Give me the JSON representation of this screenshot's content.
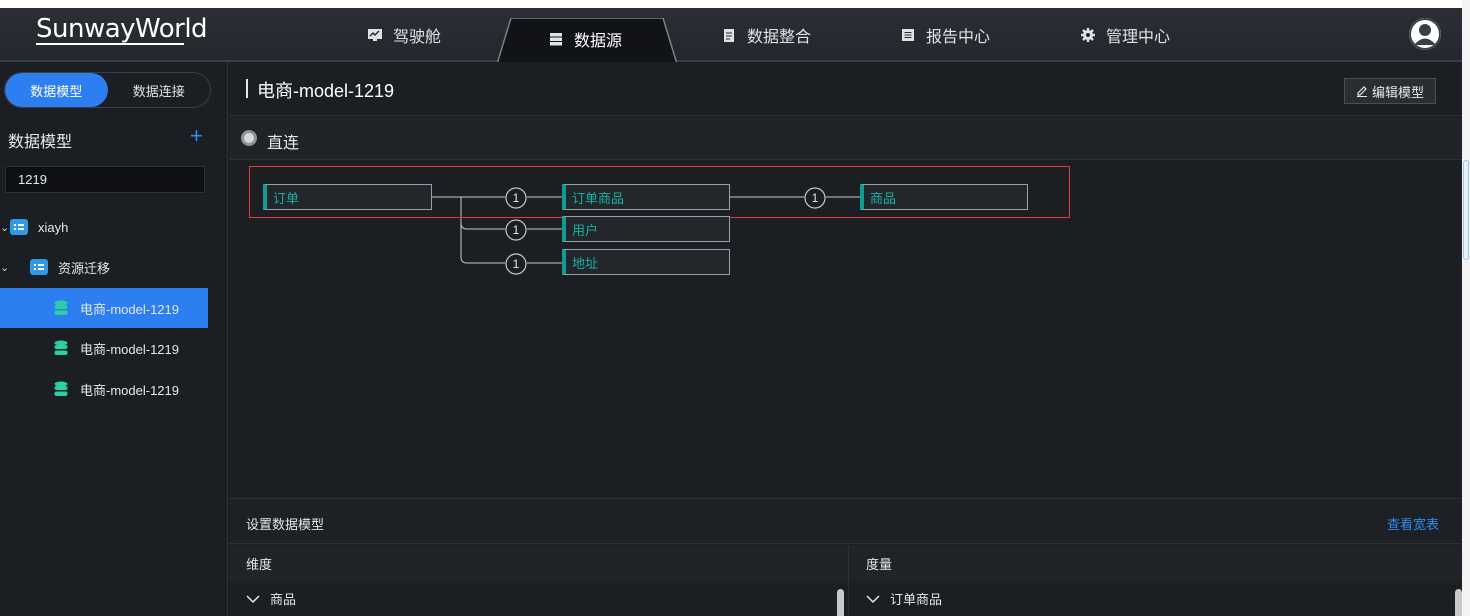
{
  "app": {
    "logo": "SunwayWorld"
  },
  "nav": {
    "items": [
      {
        "label": "驾驶舱",
        "icon": "monitor-icon"
      },
      {
        "label": "数据源",
        "icon": "server-icon",
        "active": true
      },
      {
        "label": "数据整合",
        "icon": "document-icon"
      },
      {
        "label": "报告中心",
        "icon": "list-icon"
      },
      {
        "label": "管理中心",
        "icon": "gear-icon"
      }
    ]
  },
  "sidebar": {
    "tabs": [
      "数据模型",
      "数据连接"
    ],
    "active_tab": "数据模型",
    "section_title": "数据模型",
    "add_label": "+",
    "search_value": "1219",
    "tree": [
      {
        "label": "xiayh",
        "type": "folder",
        "level": 0
      },
      {
        "label": "资源迁移",
        "type": "folder",
        "level": 1
      },
      {
        "label": "电商-model-1219",
        "type": "model",
        "level": 2,
        "selected": true
      },
      {
        "label": "电商-model-1219",
        "type": "model",
        "level": 2
      },
      {
        "label": "电商-model-1219",
        "type": "model",
        "level": 2
      }
    ]
  },
  "main": {
    "title": "电商-model-1219",
    "edit_button": "编辑模型",
    "connection_mode": "直连",
    "diagram": {
      "nodes": [
        "订单",
        "订单商品",
        "商品",
        "用户",
        "地址"
      ],
      "join_labels": [
        "1",
        "1",
        "1",
        "1"
      ]
    },
    "settings_title": "设置数据模型",
    "wide_table_link": "查看宽表",
    "dimensions_header": "维度",
    "measures_header": "度量",
    "dimension_group": "商品",
    "measure_group": "订单商品"
  },
  "colors": {
    "accent": "#2d7ef0",
    "node_teal": "#1ab0a6",
    "selection_red": "#e53935",
    "background": "#1b1e22"
  }
}
